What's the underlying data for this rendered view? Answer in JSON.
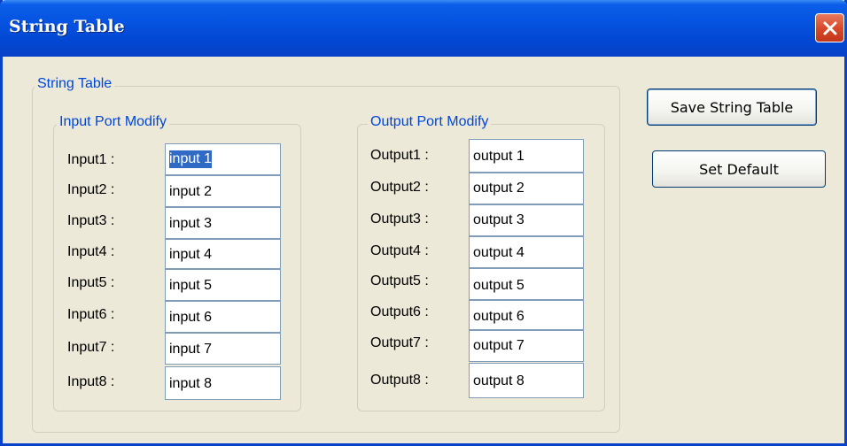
{
  "window": {
    "title": "String Table",
    "close_icon": "close-icon"
  },
  "string_group": {
    "legend": "String Table"
  },
  "input_group": {
    "legend": "Input Port Modify",
    "rows": [
      {
        "label": "Input1 :",
        "value": "input 1"
      },
      {
        "label": "Input2 :",
        "value": "input 2"
      },
      {
        "label": "Input3 :",
        "value": "input 3"
      },
      {
        "label": "Input4 :",
        "value": "input 4"
      },
      {
        "label": "Input5 :",
        "value": "input 5"
      },
      {
        "label": "Input6 :",
        "value": "input 6"
      },
      {
        "label": "Input7 :",
        "value": "input 7"
      },
      {
        "label": "Input8 :",
        "value": "input 8"
      }
    ]
  },
  "output_group": {
    "legend": "Output Port Modify",
    "rows": [
      {
        "label": "Output1 :",
        "value": "output 1"
      },
      {
        "label": "Output2 :",
        "value": "output 2"
      },
      {
        "label": "Output3 :",
        "value": "output 3"
      },
      {
        "label": "Output4 :",
        "value": "output 4"
      },
      {
        "label": "Output5 :",
        "value": "output 5"
      },
      {
        "label": "Output6 :",
        "value": "output 6"
      },
      {
        "label": "Output7 :",
        "value": "output 7"
      },
      {
        "label": "Output8 :",
        "value": "output 8"
      }
    ]
  },
  "buttons": {
    "save_label": "Save String Table",
    "default_label": "Set Default"
  },
  "colors": {
    "titlebar": "#0553e0",
    "window_bg": "#ece9d8",
    "legend_text": "#0046d5",
    "close_button": "#d94a2b",
    "selection": "#316ac5"
  }
}
